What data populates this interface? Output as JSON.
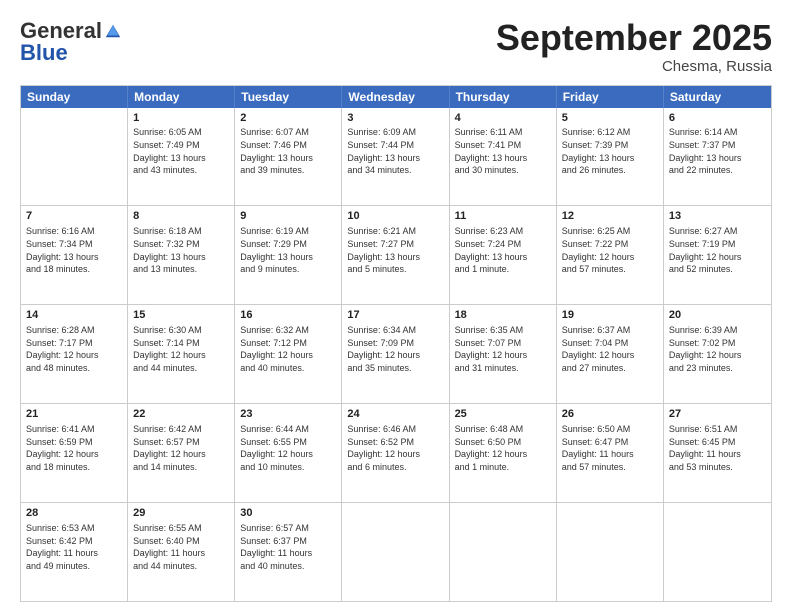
{
  "header": {
    "logo_general": "General",
    "logo_blue": "Blue",
    "month_title": "September 2025",
    "location": "Chesma, Russia"
  },
  "days_of_week": [
    "Sunday",
    "Monday",
    "Tuesday",
    "Wednesday",
    "Thursday",
    "Friday",
    "Saturday"
  ],
  "weeks": [
    [
      {
        "day": "",
        "info": ""
      },
      {
        "day": "1",
        "info": "Sunrise: 6:05 AM\nSunset: 7:49 PM\nDaylight: 13 hours\nand 43 minutes."
      },
      {
        "day": "2",
        "info": "Sunrise: 6:07 AM\nSunset: 7:46 PM\nDaylight: 13 hours\nand 39 minutes."
      },
      {
        "day": "3",
        "info": "Sunrise: 6:09 AM\nSunset: 7:44 PM\nDaylight: 13 hours\nand 34 minutes."
      },
      {
        "day": "4",
        "info": "Sunrise: 6:11 AM\nSunset: 7:41 PM\nDaylight: 13 hours\nand 30 minutes."
      },
      {
        "day": "5",
        "info": "Sunrise: 6:12 AM\nSunset: 7:39 PM\nDaylight: 13 hours\nand 26 minutes."
      },
      {
        "day": "6",
        "info": "Sunrise: 6:14 AM\nSunset: 7:37 PM\nDaylight: 13 hours\nand 22 minutes."
      }
    ],
    [
      {
        "day": "7",
        "info": "Sunrise: 6:16 AM\nSunset: 7:34 PM\nDaylight: 13 hours\nand 18 minutes."
      },
      {
        "day": "8",
        "info": "Sunrise: 6:18 AM\nSunset: 7:32 PM\nDaylight: 13 hours\nand 13 minutes."
      },
      {
        "day": "9",
        "info": "Sunrise: 6:19 AM\nSunset: 7:29 PM\nDaylight: 13 hours\nand 9 minutes."
      },
      {
        "day": "10",
        "info": "Sunrise: 6:21 AM\nSunset: 7:27 PM\nDaylight: 13 hours\nand 5 minutes."
      },
      {
        "day": "11",
        "info": "Sunrise: 6:23 AM\nSunset: 7:24 PM\nDaylight: 13 hours\nand 1 minute."
      },
      {
        "day": "12",
        "info": "Sunrise: 6:25 AM\nSunset: 7:22 PM\nDaylight: 12 hours\nand 57 minutes."
      },
      {
        "day": "13",
        "info": "Sunrise: 6:27 AM\nSunset: 7:19 PM\nDaylight: 12 hours\nand 52 minutes."
      }
    ],
    [
      {
        "day": "14",
        "info": "Sunrise: 6:28 AM\nSunset: 7:17 PM\nDaylight: 12 hours\nand 48 minutes."
      },
      {
        "day": "15",
        "info": "Sunrise: 6:30 AM\nSunset: 7:14 PM\nDaylight: 12 hours\nand 44 minutes."
      },
      {
        "day": "16",
        "info": "Sunrise: 6:32 AM\nSunset: 7:12 PM\nDaylight: 12 hours\nand 40 minutes."
      },
      {
        "day": "17",
        "info": "Sunrise: 6:34 AM\nSunset: 7:09 PM\nDaylight: 12 hours\nand 35 minutes."
      },
      {
        "day": "18",
        "info": "Sunrise: 6:35 AM\nSunset: 7:07 PM\nDaylight: 12 hours\nand 31 minutes."
      },
      {
        "day": "19",
        "info": "Sunrise: 6:37 AM\nSunset: 7:04 PM\nDaylight: 12 hours\nand 27 minutes."
      },
      {
        "day": "20",
        "info": "Sunrise: 6:39 AM\nSunset: 7:02 PM\nDaylight: 12 hours\nand 23 minutes."
      }
    ],
    [
      {
        "day": "21",
        "info": "Sunrise: 6:41 AM\nSunset: 6:59 PM\nDaylight: 12 hours\nand 18 minutes."
      },
      {
        "day": "22",
        "info": "Sunrise: 6:42 AM\nSunset: 6:57 PM\nDaylight: 12 hours\nand 14 minutes."
      },
      {
        "day": "23",
        "info": "Sunrise: 6:44 AM\nSunset: 6:55 PM\nDaylight: 12 hours\nand 10 minutes."
      },
      {
        "day": "24",
        "info": "Sunrise: 6:46 AM\nSunset: 6:52 PM\nDaylight: 12 hours\nand 6 minutes."
      },
      {
        "day": "25",
        "info": "Sunrise: 6:48 AM\nSunset: 6:50 PM\nDaylight: 12 hours\nand 1 minute."
      },
      {
        "day": "26",
        "info": "Sunrise: 6:50 AM\nSunset: 6:47 PM\nDaylight: 11 hours\nand 57 minutes."
      },
      {
        "day": "27",
        "info": "Sunrise: 6:51 AM\nSunset: 6:45 PM\nDaylight: 11 hours\nand 53 minutes."
      }
    ],
    [
      {
        "day": "28",
        "info": "Sunrise: 6:53 AM\nSunset: 6:42 PM\nDaylight: 11 hours\nand 49 minutes."
      },
      {
        "day": "29",
        "info": "Sunrise: 6:55 AM\nSunset: 6:40 PM\nDaylight: 11 hours\nand 44 minutes."
      },
      {
        "day": "30",
        "info": "Sunrise: 6:57 AM\nSunset: 6:37 PM\nDaylight: 11 hours\nand 40 minutes."
      },
      {
        "day": "",
        "info": ""
      },
      {
        "day": "",
        "info": ""
      },
      {
        "day": "",
        "info": ""
      },
      {
        "day": "",
        "info": ""
      }
    ]
  ]
}
